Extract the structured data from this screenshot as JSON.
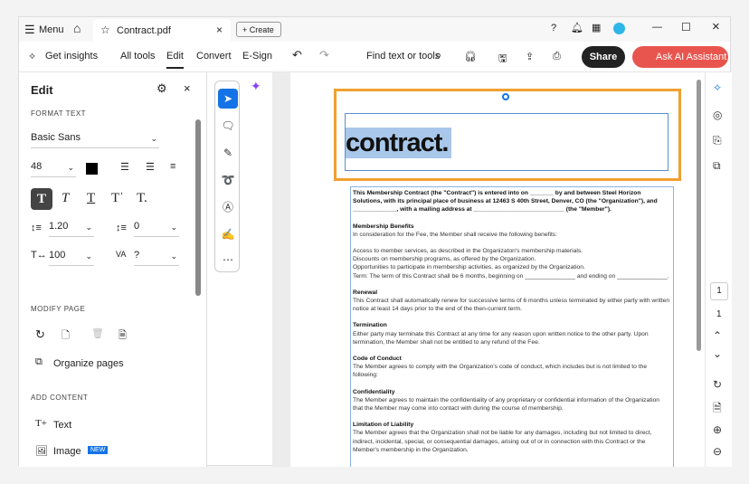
{
  "titlebar": {
    "menu": "Menu",
    "tab": "Contract.pdf",
    "create": "Create"
  },
  "toolbar": {
    "get_insights": "Get insights",
    "all_tools": "All tools",
    "edit": "Edit",
    "convert": "Convert",
    "esign": "E-Sign",
    "find": "Find text or tools",
    "share": "Share",
    "ai": "Ask AI Assistant"
  },
  "panel": {
    "title": "Edit",
    "format_text": "FORMAT TEXT",
    "font": "Basic Sans",
    "size": "48",
    "line_spacing": "1.20",
    "para_spacing": "0",
    "scale": "100",
    "tracking": "?",
    "modify_page": "MODIFY PAGE",
    "organize": "Organize pages",
    "add_content": "ADD CONTENT",
    "text": "Text",
    "image": "Image",
    "new_badge": "NEW"
  },
  "document": {
    "heading": "contract.",
    "intro": "This Membership Contract (the \"Contract\") is entered into on _______ by and between Steel Horizon Solutions, with its principal place of business at 12463 S 40th Street, Denver, CO (the \"Organization\"), and _____________, with a mailing address at ___________________________ (the \"Member\").",
    "sections": [
      {
        "title": "Membership Benefits",
        "body": "In consideration for the Fee, the Member shall receive the following benefits:"
      },
      {
        "title": "",
        "body": "Access to member services, as described in the Organizaton's membership materials.\nDiscounts on membership programs, as offered by the Organization.\nOpportunities to participate in membership activities, as organized by the Organization.\nTerm: The term of this Contract shall be 6 months, beginning on _______________ and ending on _______________."
      },
      {
        "title": "Renewal",
        "body": "This Contract shall automatically renew for successive terms of 6 months unless terminated by either party with written notice at least 14 days prior to the end of the then-current term."
      },
      {
        "title": "Termination",
        "body": "Either party may terminate this Contract at any time for any reason upon written notice to the other party. Upon termination, the Member shall not be entitled to any refund of the Fee."
      },
      {
        "title": "Code of Conduct",
        "body": "The Member agrees to comply with the Organization's code of conduct, which includes but is not limited to the following:"
      },
      {
        "title": "Confidentiality",
        "body": "The Member agrees to maintain the confidentiality of any proprietary or confidential information of the Organization that the Member may come into contact with during the course of membership."
      },
      {
        "title": "Limitation of Liability",
        "body": "The Member agrees that the Organization shall not be liable for any damages, including but not limited to direct, indirect, incidental, special, or consequential damages, arising out of or in connection with this Contract or the Member's membership in the Organization."
      }
    ]
  },
  "rail": {
    "page_current": "1",
    "page_total": "1"
  },
  "colors": {
    "accent": "#1473e6",
    "selection_box": "#f0a030",
    "ai": "#e8554e"
  }
}
